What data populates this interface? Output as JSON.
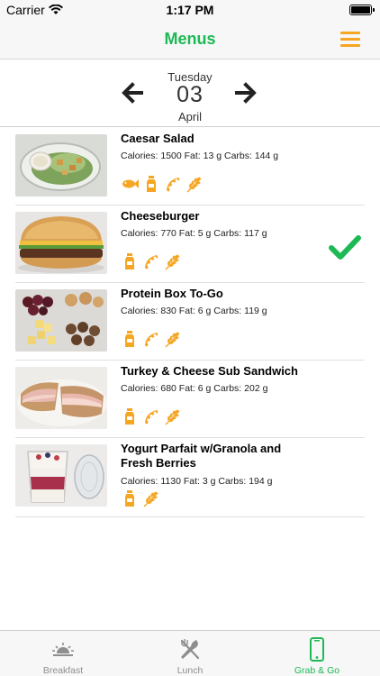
{
  "status_bar": {
    "carrier": "Carrier",
    "time": "1:17 PM"
  },
  "nav": {
    "title": "Menus",
    "menu_icon": "hamburger-icon"
  },
  "date": {
    "weekday": "Tuesday",
    "day": "03",
    "month": "April"
  },
  "items": [
    {
      "name": "Caesar Salad",
      "nutrition": "Calories: 1500 Fat: 13 g Carbs: 144 g",
      "allergens": [
        "fish",
        "milk",
        "soy",
        "wheat"
      ],
      "selected": false
    },
    {
      "name": "Cheeseburger",
      "nutrition": "Calories: 770 Fat: 5 g Carbs: 117 g",
      "allergens": [
        "milk",
        "soy",
        "wheat"
      ],
      "selected": true
    },
    {
      "name": "Protein Box To-Go",
      "nutrition": "Calories: 830 Fat: 6 g Carbs: 119 g",
      "allergens": [
        "milk",
        "soy",
        "wheat"
      ],
      "selected": false
    },
    {
      "name": "Turkey & Cheese Sub Sandwich",
      "nutrition": "Calories: 680 Fat: 6 g Carbs: 202 g",
      "allergens": [
        "milk",
        "soy",
        "wheat"
      ],
      "selected": false
    },
    {
      "name": "Yogurt Parfait w/Granola and Fresh Berries",
      "nutrition": "Calories: 1130 Fat: 3 g Carbs: 194 g",
      "allergens": [
        "milk",
        "wheat"
      ],
      "selected": false
    }
  ],
  "tabs": [
    {
      "label": "Breakfast",
      "icon": "sunrise-icon",
      "active": false
    },
    {
      "label": "Lunch",
      "icon": "fork-knife-icon",
      "active": false
    },
    {
      "label": "Grab & Go",
      "icon": "phone-icon",
      "active": true
    }
  ],
  "colors": {
    "accent_green": "#1db954",
    "allergen_orange": "#f5a623",
    "inactive_gray": "#8e8e8e"
  }
}
